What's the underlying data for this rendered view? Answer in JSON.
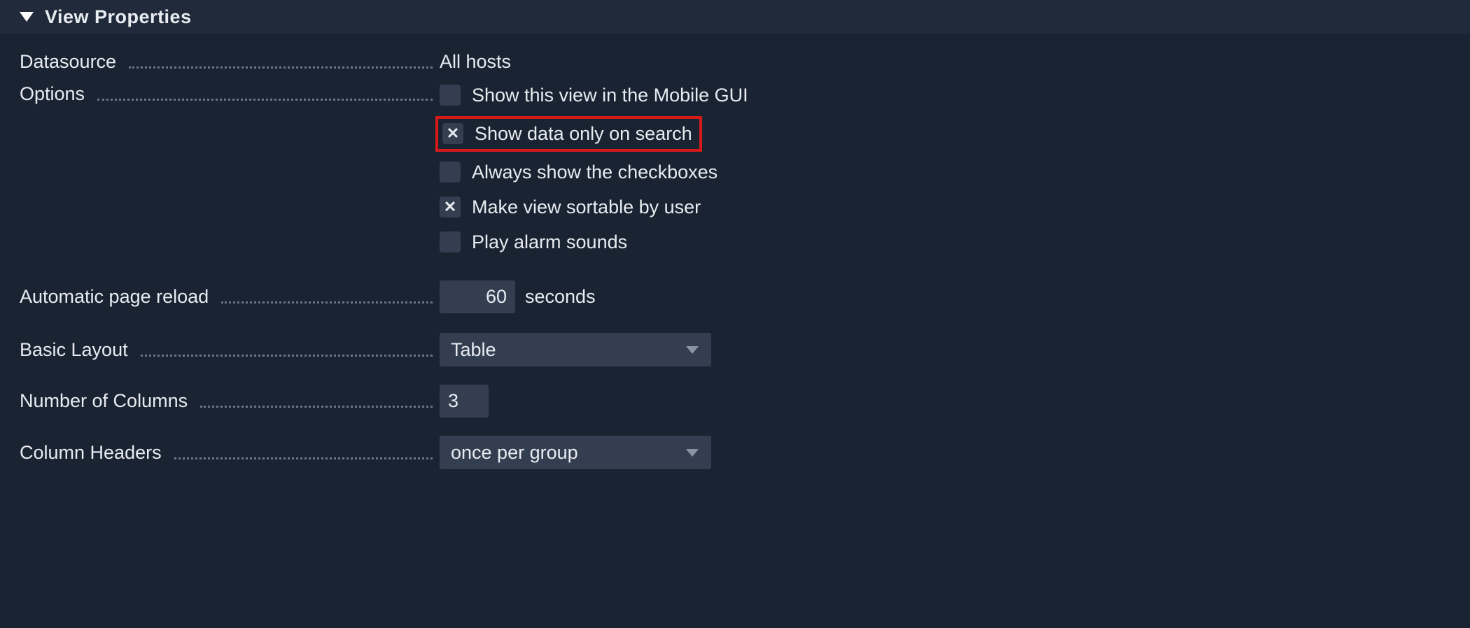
{
  "panel": {
    "title": "View Properties"
  },
  "labels": {
    "datasource": "Datasource",
    "options": "Options",
    "auto_reload": "Automatic page reload",
    "basic_layout": "Basic Layout",
    "num_columns": "Number of Columns",
    "column_headers": "Column Headers"
  },
  "values": {
    "datasource": "All hosts",
    "reload_seconds": "60",
    "reload_unit": "seconds",
    "basic_layout": "Table",
    "num_columns": "3",
    "column_headers": "once per group"
  },
  "options": {
    "mobile_gui": {
      "label": "Show this view in the Mobile GUI",
      "checked": false
    },
    "on_search": {
      "label": "Show data only on search",
      "checked": true
    },
    "always_checks": {
      "label": "Always show the checkboxes",
      "checked": false
    },
    "sortable": {
      "label": "Make view sortable by user",
      "checked": true
    },
    "alarm_sounds": {
      "label": "Play alarm sounds",
      "checked": false
    }
  }
}
